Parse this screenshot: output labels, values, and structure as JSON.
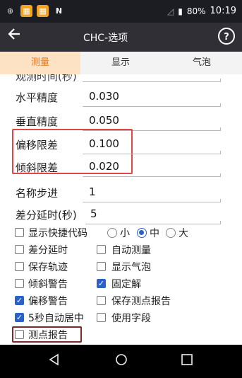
{
  "status": {
    "battery": "80%",
    "time": "10:19"
  },
  "appbar": {
    "title": "CHC-选项"
  },
  "tabs": [
    {
      "label": "测量"
    },
    {
      "label": "显示"
    },
    {
      "label": "气泡"
    }
  ],
  "settings": {
    "partial_label": "观测时间(秒)",
    "horizontal_precision": {
      "label": "水平精度",
      "value": "0.030"
    },
    "vertical_precision": {
      "label": "垂直精度",
      "value": "0.050"
    },
    "offset_limit": {
      "label": "偏移限差",
      "value": "0.100"
    },
    "tilt_limit": {
      "label": "倾斜限差",
      "value": "0.020"
    },
    "name_step": {
      "label": "名称步进",
      "value": "1"
    },
    "diff_delay": {
      "label": "差分延时(秒)",
      "value": "5"
    }
  },
  "shortcut": {
    "label": "显示快捷代码",
    "options": [
      "小",
      "中",
      "大"
    ],
    "selected": "中"
  },
  "checkboxes": {
    "diff_delay": {
      "label": "差分延时",
      "checked": false
    },
    "auto_measure": {
      "label": "自动测量",
      "checked": false
    },
    "save_track": {
      "label": "保存轨迹",
      "checked": false
    },
    "show_bubble": {
      "label": "显示气泡",
      "checked": false
    },
    "tilt_warning": {
      "label": "倾斜警告",
      "checked": false
    },
    "fixed_solution": {
      "label": "固定解",
      "checked": true
    },
    "offset_warning": {
      "label": "偏移警告",
      "checked": true
    },
    "save_point_report": {
      "label": "保存测点报告",
      "checked": false
    },
    "auto_center": {
      "label": "5秒自动居中",
      "checked": true
    },
    "use_fields": {
      "label": "使用字段",
      "checked": false
    },
    "point_report": {
      "label": "测点报告",
      "checked": false
    }
  }
}
